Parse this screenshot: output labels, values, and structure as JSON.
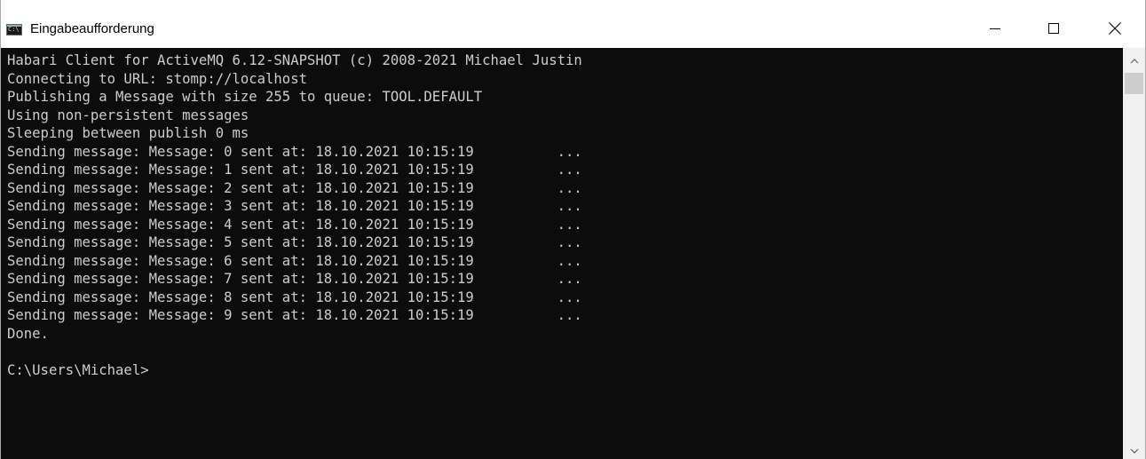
{
  "window": {
    "title": "Eingabeaufforderung",
    "app_icon": "command-prompt-icon",
    "app_icon_text": "C:\\",
    "controls": {
      "minimize": "minimize-icon",
      "maximize": "maximize-icon",
      "close": "close-icon"
    }
  },
  "console": {
    "background": "#0c0c0c",
    "foreground": "#cccccc",
    "lines": [
      "Habari Client for ActiveMQ 6.12-SNAPSHOT (c) 2008-2021 Michael Justin",
      "Connecting to URL: stomp://localhost",
      "Publishing a Message with size 255 to queue: TOOL.DEFAULT",
      "Using non-persistent messages",
      "Sleeping between publish 0 ms",
      "Sending message: Message: 0 sent at: 18.10.2021 10:15:19          ...",
      "Sending message: Message: 1 sent at: 18.10.2021 10:15:19          ...",
      "Sending message: Message: 2 sent at: 18.10.2021 10:15:19          ...",
      "Sending message: Message: 3 sent at: 18.10.2021 10:15:19          ...",
      "Sending message: Message: 4 sent at: 18.10.2021 10:15:19          ...",
      "Sending message: Message: 5 sent at: 18.10.2021 10:15:19          ...",
      "Sending message: Message: 6 sent at: 18.10.2021 10:15:19          ...",
      "Sending message: Message: 7 sent at: 18.10.2021 10:15:19          ...",
      "Sending message: Message: 8 sent at: 18.10.2021 10:15:19          ...",
      "Sending message: Message: 9 sent at: 18.10.2021 10:15:19          ...",
      "Done.",
      "",
      "C:\\Users\\Michael>"
    ]
  },
  "scrollbar": {
    "up_icon": "scroll-up-arrow-icon",
    "down_icon": "scroll-down-arrow-icon"
  }
}
